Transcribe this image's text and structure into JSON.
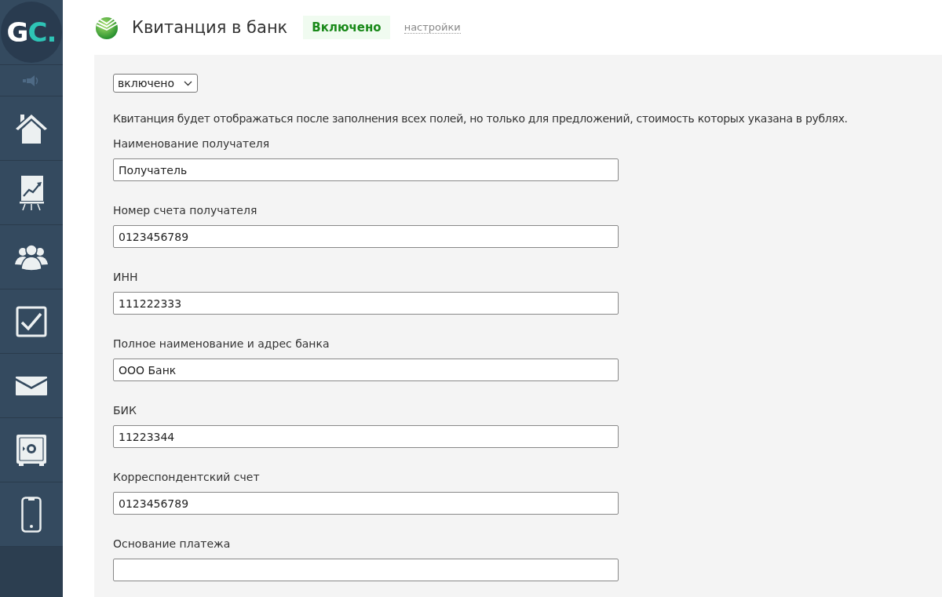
{
  "logo": {
    "letters": "GC",
    "dot": "."
  },
  "header": {
    "title": "Квитанция в банк",
    "status": {
      "label": "Включено",
      "on": true
    },
    "settings_link": "настройки"
  },
  "mode_select": {
    "value": "включено"
  },
  "note": "Квитанция будет отображаться после заполнения всех полей, но только для предложений, стоимость которых указана в рублях.",
  "fields": [
    {
      "label": "Наименование получателя",
      "value": "Получатель"
    },
    {
      "label": "Номер счета получателя",
      "value": "0123456789"
    },
    {
      "label": "ИНН",
      "value": "111222333"
    },
    {
      "label": "Полное наименование и адрес банка",
      "value": "ООО Банк"
    },
    {
      "label": "БИК",
      "value": "11223344"
    },
    {
      "label": "Корреспондентский счет",
      "value": "0123456789"
    },
    {
      "label": "Основание платежа"
    }
  ]
}
